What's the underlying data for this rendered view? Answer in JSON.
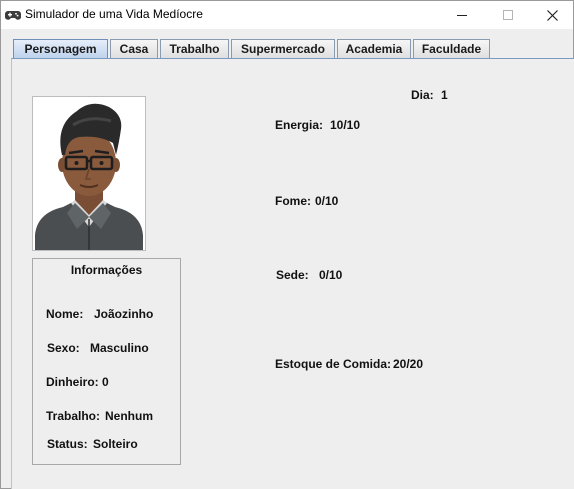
{
  "window": {
    "title": "Simulador de uma Vida Medíocre",
    "minimize_label": "—",
    "maximize_label": "☐",
    "close_label": "✕"
  },
  "tabs": [
    {
      "label": "Personagem",
      "active": true
    },
    {
      "label": "Casa",
      "active": false
    },
    {
      "label": "Trabalho",
      "active": false
    },
    {
      "label": "Supermercado",
      "active": false
    },
    {
      "label": "Academia",
      "active": false
    },
    {
      "label": "Faculdade",
      "active": false
    }
  ],
  "info": {
    "title": "Informações",
    "nome": {
      "label": "Nome:",
      "value": "Joãozinho"
    },
    "sexo": {
      "label": "Sexo:",
      "value": "Masculino"
    },
    "dinheiro": {
      "label": "Dinheiro:",
      "value": "0"
    },
    "trabalho": {
      "label": "Trabalho:",
      "value": "Nenhum"
    },
    "status": {
      "label": "Status:",
      "value": "Solteiro"
    }
  },
  "stats": {
    "dia": {
      "label": "Dia:",
      "value": "1"
    },
    "energia": {
      "label": "Energia:",
      "value": "10/10"
    },
    "fome": {
      "label": "Fome:",
      "value": "0/10"
    },
    "sede": {
      "label": "Sede:",
      "value": "0/10"
    },
    "estoque": {
      "label": "Estoque de Comida:",
      "value": "20/20"
    }
  },
  "icons": {
    "app": "gamepad-icon",
    "avatar": "avatar-man-glasses"
  },
  "colors": {
    "active_tab": "#bcd1ec",
    "tab_border": "#6f8fb8",
    "panel_bg": "#eeeeee"
  }
}
